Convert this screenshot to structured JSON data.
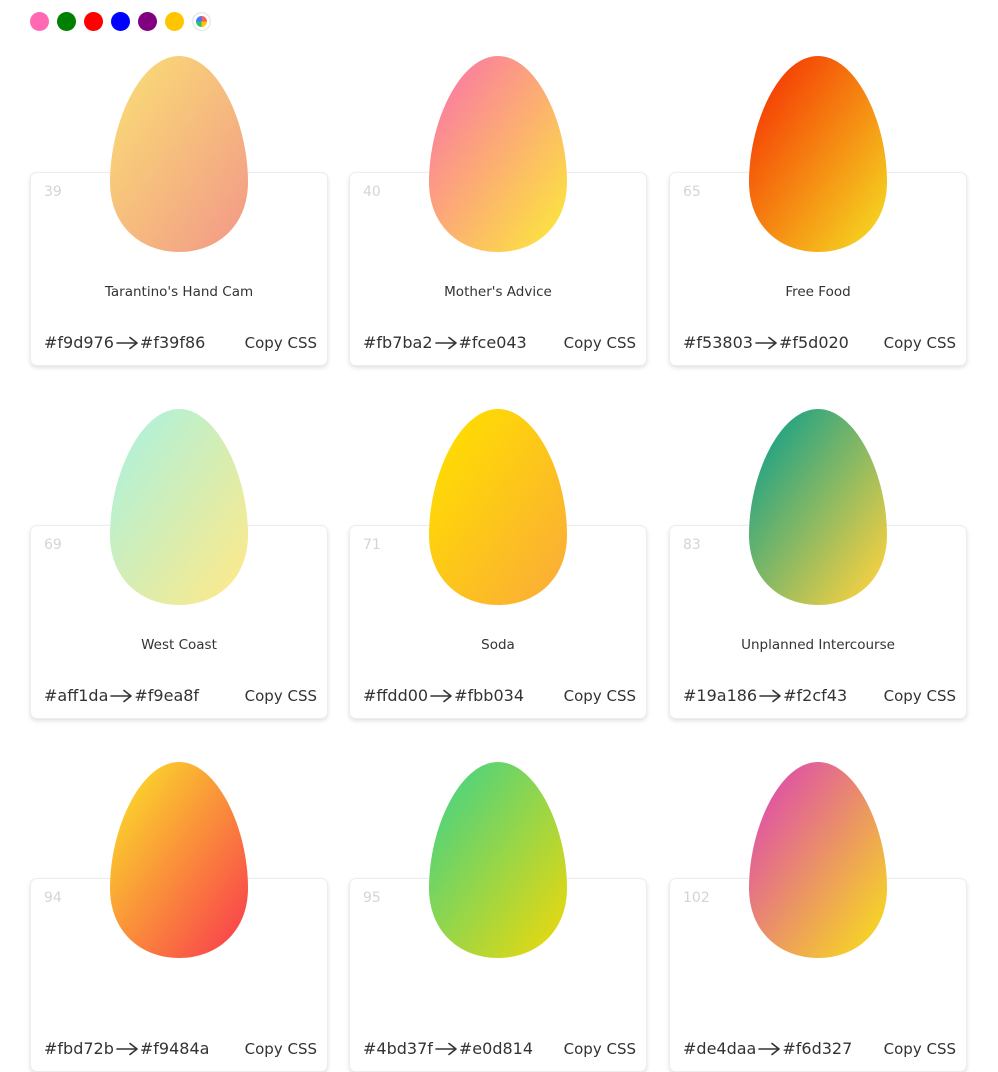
{
  "filters": [
    {
      "name": "pink-filter",
      "color": "#ff69b4"
    },
    {
      "name": "green-filter",
      "color": "#008000"
    },
    {
      "name": "red-filter",
      "color": "#ff0000"
    },
    {
      "name": "blue-filter",
      "color": "#0000ff"
    },
    {
      "name": "purple-filter",
      "color": "#800080"
    },
    {
      "name": "yellow-filter",
      "color": "#ffc600"
    },
    {
      "name": "all-colors-filter",
      "color": "multicolor"
    }
  ],
  "copy_label": "Copy CSS",
  "cards": [
    {
      "num": "39",
      "name": "Tarantino's Hand Cam",
      "from": "#f9d976",
      "to": "#f39f86"
    },
    {
      "num": "40",
      "name": "Mother's Advice",
      "from": "#fb7ba2",
      "to": "#fce043"
    },
    {
      "num": "65",
      "name": "Free Food",
      "from": "#f53803",
      "to": "#f5d020"
    },
    {
      "num": "69",
      "name": "West Coast",
      "from": "#aff1da",
      "to": "#f9ea8f"
    },
    {
      "num": "71",
      "name": "Soda",
      "from": "#ffdd00",
      "to": "#fbb034"
    },
    {
      "num": "83",
      "name": "Unplanned Intercourse",
      "from": "#19a186",
      "to": "#f2cf43"
    },
    {
      "num": "94",
      "name": "",
      "from": "#fbd72b",
      "to": "#f9484a"
    },
    {
      "num": "95",
      "name": "",
      "from": "#4bd37f",
      "to": "#e0d814"
    },
    {
      "num": "102",
      "name": "",
      "from": "#de4daa",
      "to": "#f6d327"
    }
  ]
}
